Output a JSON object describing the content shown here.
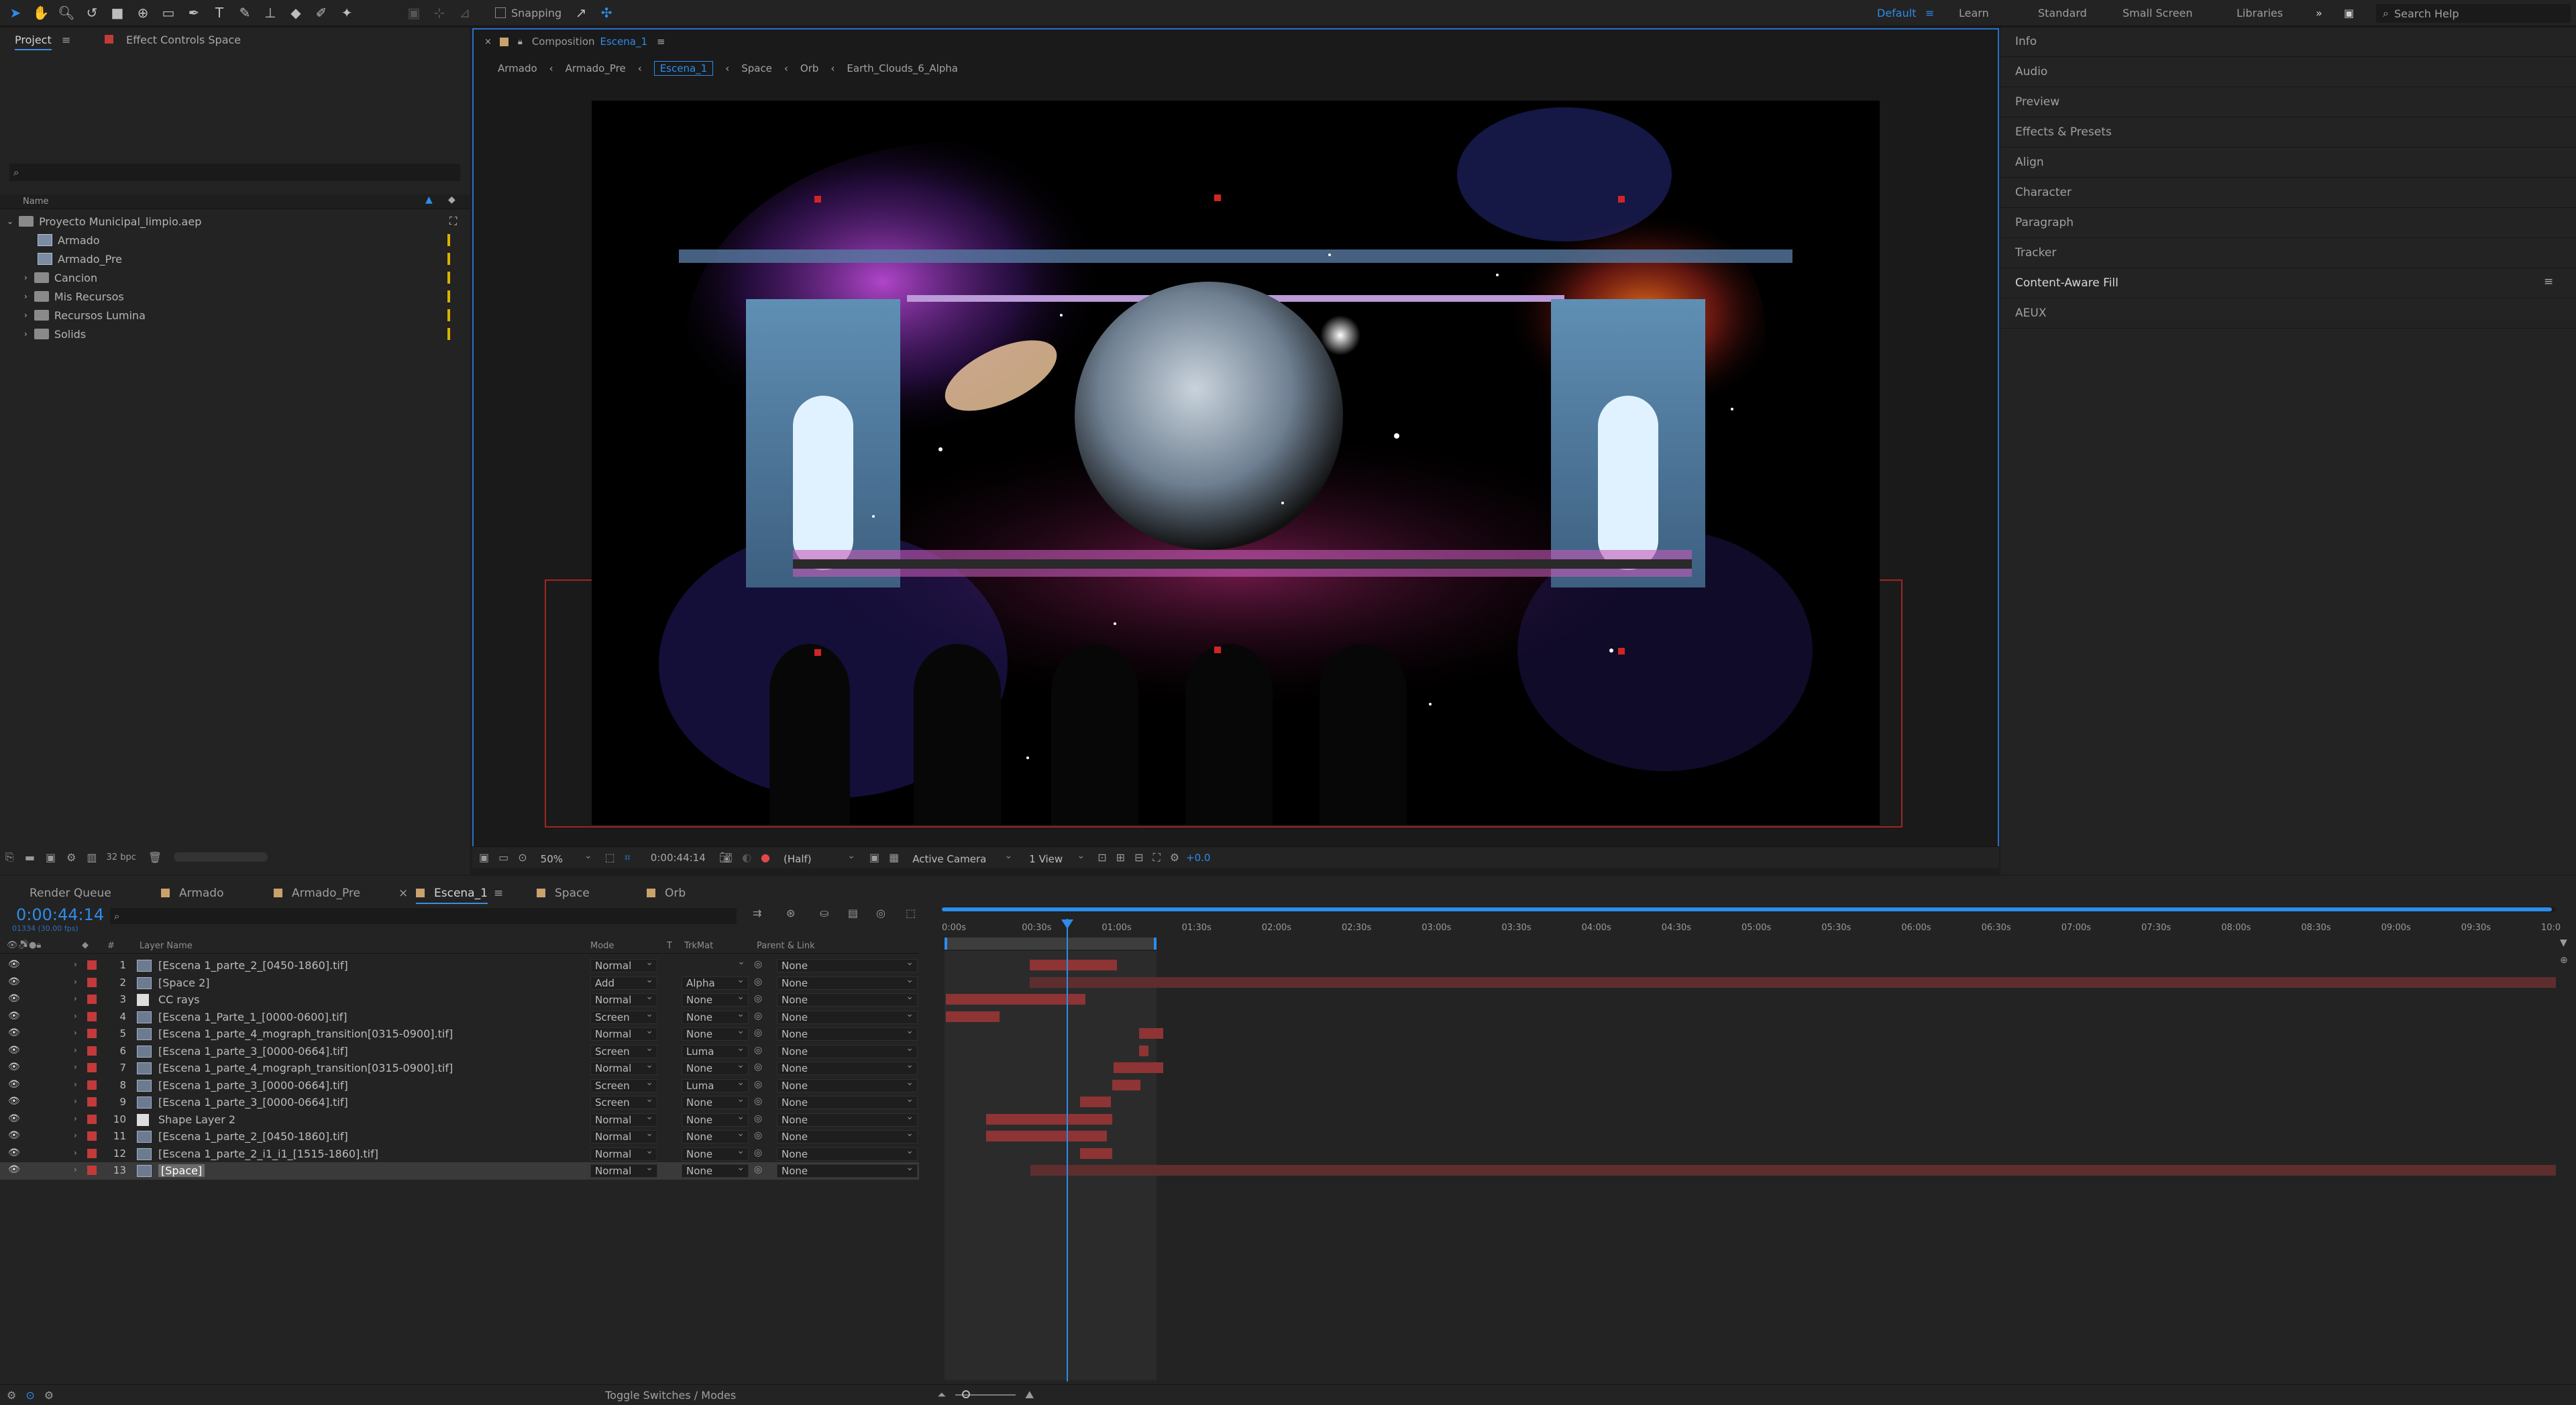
{
  "toolbar": {
    "snapping_label": "Snapping",
    "workspaces": [
      "Default",
      "Learn",
      "Standard",
      "Small Screen",
      "Libraries"
    ],
    "active_workspace": "Default",
    "search_placeholder": "Search Help"
  },
  "project_panel": {
    "tab_project": "Project",
    "tab_effects": "Effect Controls Space",
    "column_name": "Name",
    "tree": [
      {
        "name": "Proyecto Municipal_limpio.aep",
        "type": "file"
      },
      {
        "name": "Armado",
        "type": "comp"
      },
      {
        "name": "Armado_Pre",
        "type": "comp"
      },
      {
        "name": "Cancion",
        "type": "folder"
      },
      {
        "name": "Mis Recursos",
        "type": "folder"
      },
      {
        "name": "Recursos Lumina",
        "type": "folder"
      },
      {
        "name": "Solids",
        "type": "folder"
      }
    ],
    "footer_bpc": "32 bpc"
  },
  "composition": {
    "header_label": "Composition",
    "header_name": "Escena_1",
    "breadcrumbs": [
      "Armado",
      "Armado_Pre",
      "Escena_1",
      "Space",
      "Orb",
      "Earth_Clouds_6_Alpha"
    ],
    "active_breadcrumb": "Escena_1",
    "viewer": {
      "zoom": "50%",
      "timecode": "0:00:44:14",
      "resolution": "(Half)",
      "camera": "Active Camera",
      "views": "1 View",
      "exposure": "+0.0"
    }
  },
  "right_panels": [
    "Info",
    "Audio",
    "Preview",
    "Effects & Presets",
    "Align",
    "Character",
    "Paragraph",
    "Tracker",
    "Content-Aware Fill",
    "AEUX"
  ],
  "timeline": {
    "tabs": [
      "Render Queue",
      "Armado",
      "Armado_Pre",
      "Escena_1",
      "Space",
      "Orb"
    ],
    "active_tab": "Escena_1",
    "timecode": "0:00:44:14",
    "timecode_sub": "01334 (30.00 fps)",
    "columns": {
      "hash": "#",
      "layer_name": "Layer Name",
      "mode": "Mode",
      "t": "T",
      "trkmat": "TrkMat",
      "parent": "Parent & Link"
    },
    "ruler": [
      "0:00s",
      "00:30s",
      "01:00s",
      "01:30s",
      "02:00s",
      "02:30s",
      "03:00s",
      "03:30s",
      "04:00s",
      "04:30s",
      "05:00s",
      "05:30s",
      "06:00s",
      "06:30s",
      "07:00s",
      "07:30s",
      "08:00s",
      "08:30s",
      "09:00s",
      "09:30s",
      "10:0"
    ],
    "layers": [
      {
        "num": "1",
        "name": "[Escena 1_parte_2_[0450-1860].tif]",
        "mode": "Normal",
        "trkmat": "",
        "parent": "None"
      },
      {
        "num": "2",
        "name": "[Space 2]",
        "mode": "Add",
        "trkmat": "Alpha",
        "parent": "None"
      },
      {
        "num": "3",
        "name": "CC rays",
        "mode": "Normal",
        "trkmat": "None",
        "parent": "None"
      },
      {
        "num": "4",
        "name": "[Escena 1_Parte_1_[0000-0600].tif]",
        "mode": "Screen",
        "trkmat": "None",
        "parent": "None"
      },
      {
        "num": "5",
        "name": "[Escena 1_parte_4_mograph_transition[0315-0900].tif]",
        "mode": "Normal",
        "trkmat": "None",
        "parent": "None"
      },
      {
        "num": "6",
        "name": "[Escena 1_parte_3_[0000-0664].tif]",
        "mode": "Screen",
        "trkmat": "Luma",
        "parent": "None"
      },
      {
        "num": "7",
        "name": "[Escena 1_parte_4_mograph_transition[0315-0900].tif]",
        "mode": "Normal",
        "trkmat": "None",
        "parent": "None"
      },
      {
        "num": "8",
        "name": "[Escena 1_parte_3_[0000-0664].tif]",
        "mode": "Screen",
        "trkmat": "Luma",
        "parent": "None"
      },
      {
        "num": "9",
        "name": "[Escena 1_parte_3_[0000-0664].tif]",
        "mode": "Screen",
        "trkmat": "None",
        "parent": "None"
      },
      {
        "num": "10",
        "name": "Shape Layer 2",
        "mode": "Normal",
        "trkmat": "None",
        "parent": "None"
      },
      {
        "num": "11",
        "name": "[Escena 1_parte_2_[0450-1860].tif]",
        "mode": "Normal",
        "trkmat": "None",
        "parent": "None"
      },
      {
        "num": "12",
        "name": "[Escena 1_parte_2_i1_i1_[1515-1860].tif]",
        "mode": "Normal",
        "trkmat": "None",
        "parent": "None"
      },
      {
        "num": "13",
        "name": "[Space]",
        "mode": "Normal",
        "trkmat": "None",
        "parent": "None"
      }
    ],
    "footer_toggle": "Toggle Switches / Modes"
  },
  "colors": {
    "accent": "#2d8ceb",
    "layer_label": "#c33a3a",
    "bar": "#8e3434"
  }
}
